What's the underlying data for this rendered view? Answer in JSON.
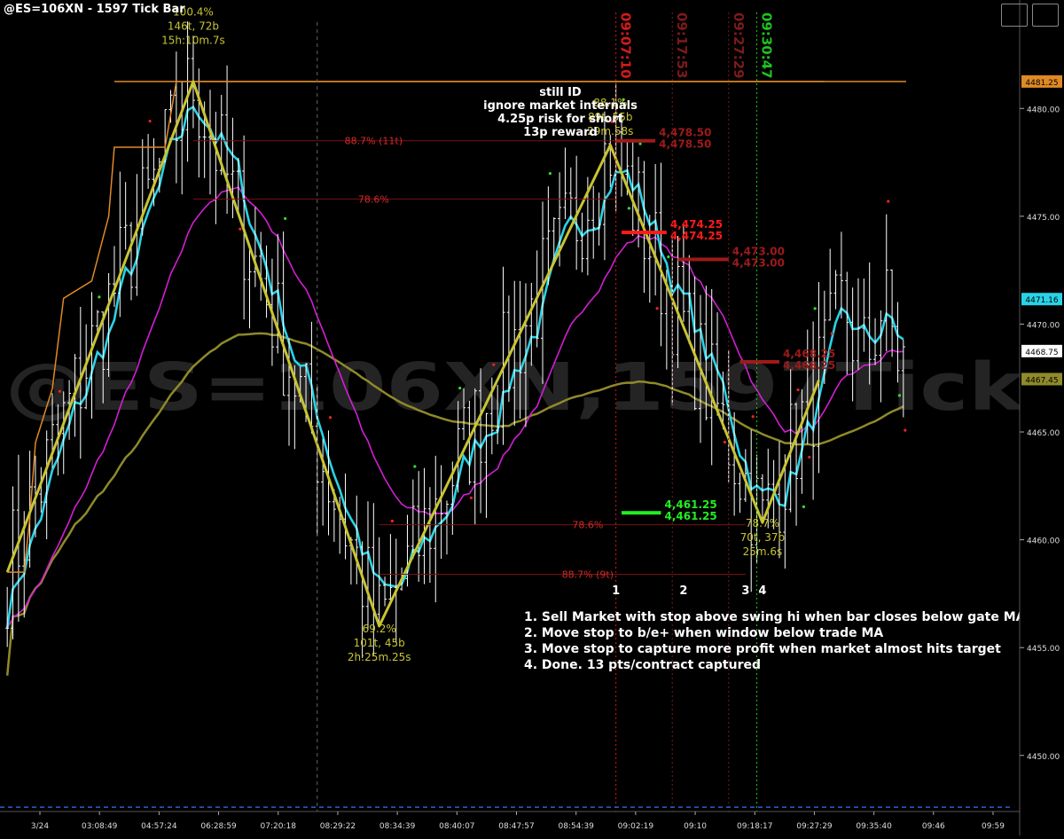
{
  "window": {
    "title": "@ES=106XN - 1597 Tick Bar",
    "watermark": "@ES=106XN,1597Tick"
  },
  "colors": {
    "background": "#000000",
    "price_bar": "#ffffff",
    "cyan_ma": "#29d3e6",
    "magenta_ma": "#d21fd2",
    "olive_ma": "#8f8a2a",
    "zigzag": "#c8c432",
    "orange_line": "#e08a25",
    "fib_line": "#7a1212",
    "fib_label": "#d42a2a",
    "stop_red": "#ff1a1a",
    "target_green": "#22ee22",
    "dashed_blue": "#2f5fd0"
  },
  "chart_data": {
    "type": "candlestick",
    "instrument": "@ES=106XN",
    "bar_type": "1597 Tick Bar",
    "y_axis": {
      "ticks": [
        4450,
        4455,
        4460,
        4465,
        4470,
        4475,
        4480
      ],
      "tick_labels": [
        "4450.00",
        "4455.00",
        "4460.00",
        "4465.00",
        "4470.00",
        "4475.00",
        "4480.00"
      ],
      "ylim": [
        4447.4,
        4484.0
      ]
    },
    "x_axis": {
      "tick_labels": [
        "3/24",
        "03:08:49",
        "04:57:24",
        "06:28:59",
        "07:20:18",
        "08:29:22",
        "08:34:39",
        "08:40:07",
        "08:47:57",
        "08:54:39",
        "09:02:19",
        "09:10",
        "09:18:17",
        "09:27:29",
        "09:35:40",
        "09:46",
        "09:59"
      ],
      "bar_count": 160
    },
    "price_markers": [
      {
        "label": "4481.25",
        "value": 4481.25,
        "color": "#e08a25"
      },
      {
        "label": "4471.16",
        "value": 4471.16,
        "color": "#29d3e6"
      },
      {
        "label": "4468.75",
        "value": 4468.75,
        "color": "#ffffff"
      },
      {
        "label": "4467.45",
        "value": 4467.45,
        "color": "#8f8a2a"
      }
    ],
    "series": [
      {
        "kind": "zigzag",
        "points": [
          [
            0,
            4458.5
          ],
          [
            33,
            4481.25
          ],
          [
            66,
            4456
          ],
          [
            107,
            4478.3
          ],
          [
            134,
            4460.8
          ],
          [
            144,
            4467.4
          ]
        ]
      },
      {
        "kind": "orange_step",
        "points": [
          [
            0,
            4458.5
          ],
          [
            3,
            4458.5
          ],
          [
            4,
            4461
          ],
          [
            5,
            4464.5
          ],
          [
            8,
            4467
          ],
          [
            10,
            4471.2
          ],
          [
            15,
            4472
          ],
          [
            17,
            4474
          ],
          [
            18,
            4475
          ],
          [
            19,
            4478.2
          ],
          [
            28,
            4478.2
          ],
          [
            30,
            4481.25
          ],
          [
            145,
            4481.25
          ]
        ]
      }
    ],
    "zigzag_labels": [
      {
        "lines": [
          "100.4%",
          "146t, 72b",
          "15h:10m.7s"
        ],
        "bar": 33,
        "value": 4484.3
      },
      {
        "lines": [
          "69.2%",
          "101t, 45b",
          "2h:25m.25s"
        ],
        "bar": 66,
        "value": 4455.7
      },
      {
        "lines": [
          "88.1%",
          "89t, 55b",
          "29m.58s"
        ],
        "bar": 107,
        "value": 4480.1
      },
      {
        "lines": [
          "78.7%",
          "70t, 37b",
          "25m.6s"
        ],
        "bar": 134,
        "value": 4460.6
      }
    ],
    "fib_levels": [
      {
        "label": "88.7% (11t)",
        "value": 4478.5
      },
      {
        "label": "78.6%",
        "value": 4475.8
      },
      {
        "label": "78.6%",
        "value": 4460.7
      },
      {
        "label": "88.7% (9t)",
        "value": 4458.4
      }
    ],
    "trade_levels": [
      {
        "text": "4,478.50",
        "value": 4478.5,
        "color": "#9e1a1a",
        "x0": 108,
        "x1": 115
      },
      {
        "text": "4,474.25",
        "value": 4474.25,
        "color": "#ff1a1a",
        "x0": 109,
        "x1": 117
      },
      {
        "text": "4,473.00",
        "value": 4473.0,
        "color": "#9e1a1a",
        "x0": 119,
        "x1": 128
      },
      {
        "text": "4,461.25",
        "value": 4461.25,
        "color": "#22ee22",
        "x0": 109,
        "x1": 116
      },
      {
        "text": "4,468.25",
        "value": 4468.25,
        "color": "#9e1a1a",
        "x0": 130,
        "x1": 137
      }
    ],
    "time_markers": [
      {
        "label": "09:07:10",
        "bar": 108,
        "color": "#d61a1a"
      },
      {
        "label": "09:17:53",
        "bar": 118,
        "color": "#7d1a1a"
      },
      {
        "label": "09:27:29",
        "bar": 128,
        "color": "#7d1a1a"
      },
      {
        "label": "09:30:47",
        "bar": 133,
        "color": "#1ec41e"
      }
    ],
    "step_numbers": [
      {
        "label": "1",
        "bar": 108
      },
      {
        "label": "2",
        "bar": 120
      },
      {
        "label": "3",
        "bar": 131
      },
      {
        "label": "4",
        "bar": 134
      }
    ]
  },
  "notes": {
    "top": [
      "still ID",
      "ignore market internals",
      "4.25p risk for short",
      "13p reward"
    ],
    "steps": [
      "1. Sell Market with stop above swing hi when bar closes below gate MA",
      "2. Move stop to b/e+ when window below trade MA",
      "3. Move stop to capture more profit when market almost hits target",
      "4. Done. 13 pts/contract captured"
    ]
  }
}
